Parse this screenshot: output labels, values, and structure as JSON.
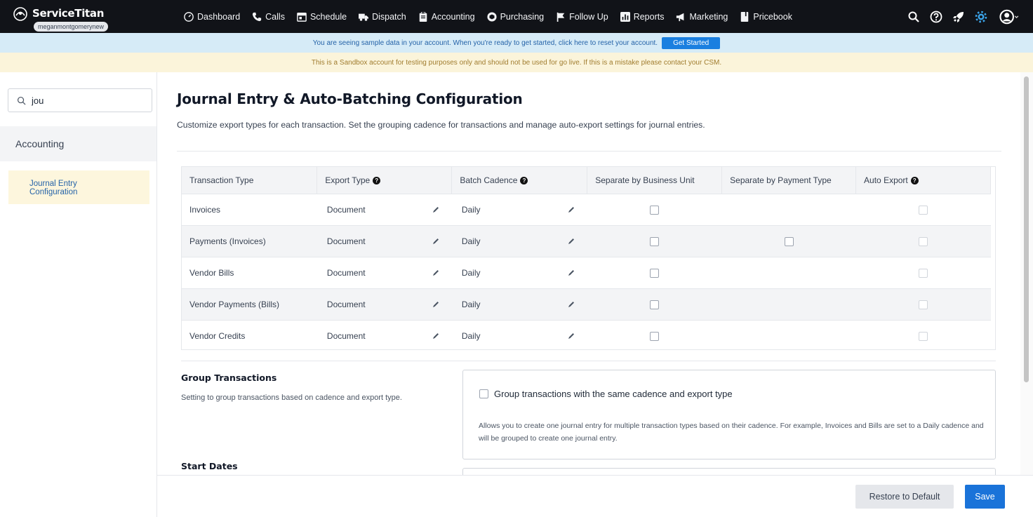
{
  "app": {
    "brand": "ServiceTitan",
    "account": "meganmontgomerynew"
  },
  "nav": {
    "items": [
      {
        "label": "Dashboard",
        "icon": "dashboard-icon"
      },
      {
        "label": "Calls",
        "icon": "phone-icon"
      },
      {
        "label": "Schedule",
        "icon": "calendar-icon"
      },
      {
        "label": "Dispatch",
        "icon": "truck-icon"
      },
      {
        "label": "Accounting",
        "icon": "clipboard-icon"
      },
      {
        "label": "Purchasing",
        "icon": "box-icon"
      },
      {
        "label": "Follow Up",
        "icon": "flag-icon"
      },
      {
        "label": "Reports",
        "icon": "chart-icon"
      },
      {
        "label": "Marketing",
        "icon": "megaphone-icon"
      },
      {
        "label": "Pricebook",
        "icon": "book-icon"
      }
    ],
    "right_icons": [
      "search-icon",
      "help-icon",
      "rocket-icon",
      "gear-icon",
      "user-avatar-icon"
    ]
  },
  "banners": {
    "sample": "You are seeing sample data in your account. When you're ready to get started, click here to reset your account.",
    "sample_button": "Get Started",
    "sandbox": "This is a Sandbox account for testing purposes only and should not be used for go live. If this is a mistake please contact your CSM."
  },
  "sidebar": {
    "search_value": "jou",
    "section": "Accounting",
    "item_line1": "Journal Entry",
    "item_line2": "Configuration"
  },
  "page": {
    "title": "Journal Entry & Auto-Batching Configuration",
    "description": "Customize export types for each transaction. Set the grouping cadence for transactions and manage auto-export settings for journal entries."
  },
  "table": {
    "headers": {
      "transaction_type": "Transaction Type",
      "export_type": "Export Type",
      "batch_cadence": "Batch Cadence",
      "separate_bu": "Separate by Business Unit",
      "separate_pt": "Separate by Payment Type",
      "auto_export": "Auto Export"
    },
    "rows": [
      {
        "type": "Invoices",
        "export": "Document",
        "cadence": "Daily",
        "separate_bu": false,
        "separate_pt": null,
        "auto_export": false
      },
      {
        "type": "Payments (Invoices)",
        "export": "Document",
        "cadence": "Daily",
        "separate_bu": false,
        "separate_pt": false,
        "auto_export": false
      },
      {
        "type": "Vendor Bills",
        "export": "Document",
        "cadence": "Daily",
        "separate_bu": false,
        "separate_pt": null,
        "auto_export": false
      },
      {
        "type": "Vendor Payments (Bills)",
        "export": "Document",
        "cadence": "Daily",
        "separate_bu": false,
        "separate_pt": null,
        "auto_export": false
      },
      {
        "type": "Vendor Credits",
        "export": "Document",
        "cadence": "Daily",
        "separate_bu": false,
        "separate_pt": null,
        "auto_export": false
      }
    ]
  },
  "group": {
    "title": "Group Transactions",
    "description": "Setting to group transactions based on cadence and export type.",
    "option": "Group transactions with the same cadence and export type",
    "help": "Allows you to create one journal entry for multiple transaction types based on their cadence. For example, Invoices and Bills are set to a Daily cadence and will be grouped to create one journal entry."
  },
  "start_dates": {
    "title": "Start Dates"
  },
  "footer": {
    "restore": "Restore to Default",
    "save": "Save"
  }
}
